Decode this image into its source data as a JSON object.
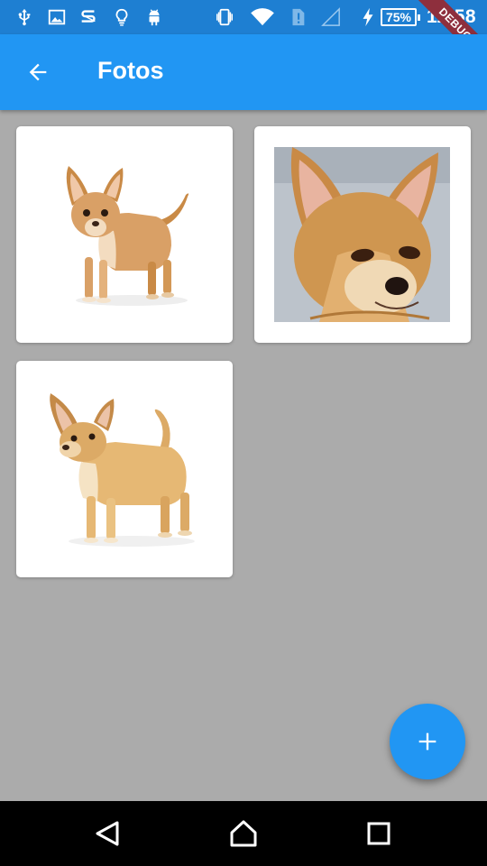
{
  "status_bar": {
    "battery": "75%",
    "time": "11:58",
    "debug_label": "DEBUG",
    "icons": [
      "usb-icon",
      "image-icon",
      "s-app-icon",
      "lightbulb-icon",
      "android-icon",
      "vibrate-icon",
      "wifi-icon",
      "sim-alert-icon",
      "cell-signal-icon",
      "charging-icon",
      "battery-icon"
    ]
  },
  "app_bar": {
    "title": "Fotos",
    "back_icon": "arrow-back-icon",
    "color": "#2196f3"
  },
  "photos": [
    {
      "subject": "chihuahua-full-body-tan"
    },
    {
      "subject": "chihuahua-face-closeup"
    },
    {
      "subject": "chihuahua-full-body-fawn"
    }
  ],
  "fab": {
    "icon": "plus-icon",
    "color": "#2196f3"
  },
  "nav_bar": {
    "icons": [
      "nav-back-icon",
      "nav-home-icon",
      "nav-recent-icon"
    ]
  },
  "colors": {
    "background": "#ababab",
    "status_bar": "#1e7fd2",
    "debug_ribbon": "#8e2f3d"
  }
}
